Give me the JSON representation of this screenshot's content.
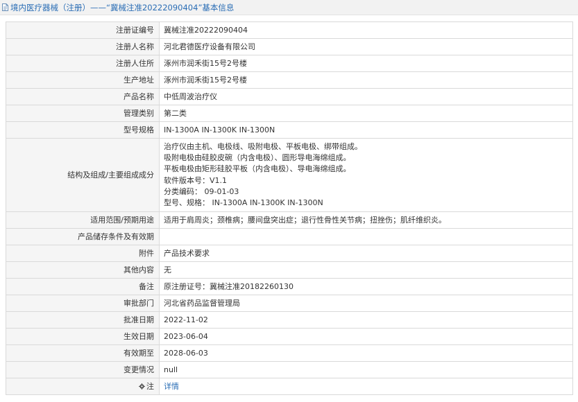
{
  "header": {
    "title": "境内医疗器械（注册）——“冀械注准20222090404”基本信息"
  },
  "rows": [
    {
      "label": "注册证编号",
      "value": "冀械注准20222090404"
    },
    {
      "label": "注册人名称",
      "value": "河北君德医疗设备有限公司"
    },
    {
      "label": "注册人住所",
      "value": "涿州市润禾街15号2号楼"
    },
    {
      "label": "生产地址",
      "value": "涿州市润禾街15号2号楼"
    },
    {
      "label": "产品名称",
      "value": "中低周波治疗仪"
    },
    {
      "label": "管理类别",
      "value": "第二类"
    },
    {
      "label": "型号规格",
      "value": "IN-1300A IN-1300K IN-1300N"
    },
    {
      "label": "结构及组成/主要组成成分",
      "lines": [
        "治疗仪由主机、电极线、吸附电极、平板电极、绑带组成。",
        "吸附电极由硅胶皮碗（内含电极）、圆形导电海绵组成。",
        "平板电极由矩形硅胶平板（内含电极）、导电海绵组成。",
        "软件版本号：V1.1",
        "分类编码： 09-01-03",
        "型号、规格： IN-1300A IN-1300K IN-1300N"
      ]
    },
    {
      "label": "适用范围/预期用途",
      "value": "适用于肩周炎；颈椎病；腰间盘突出症；退行性骨性关节病；扭挫伤；肌纤维织炎。"
    },
    {
      "label": "产品储存条件及有效期",
      "value": ""
    },
    {
      "label": "附件",
      "value": "产品技术要求"
    },
    {
      "label": "其他内容",
      "value": "无"
    },
    {
      "label": "备注",
      "value": "原注册证号：冀械注准20182260130"
    },
    {
      "label": "审批部门",
      "value": "河北省药品监督管理局"
    },
    {
      "label": "批准日期",
      "value": "2022-11-02"
    },
    {
      "label": "生效日期",
      "value": "2023-06-04"
    },
    {
      "label": "有效期至",
      "value": "2028-06-03"
    },
    {
      "label": "变更情况",
      "value": "null"
    },
    {
      "label": "注",
      "value": "详情"
    }
  ],
  "icons": {
    "header": "document-icon",
    "note": "gear-icon"
  },
  "colors": {
    "link": "#2a6db5",
    "label_bg": "#f5f5f5",
    "border": "#d9d9d9"
  }
}
